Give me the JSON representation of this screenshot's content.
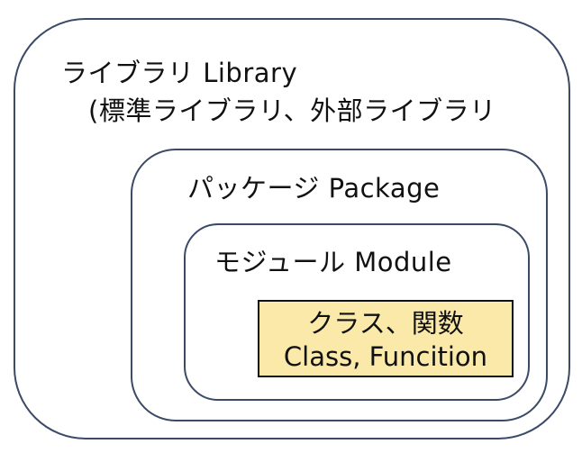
{
  "diagram": {
    "library": {
      "title": "ライブラリ Library",
      "subtitle": "(標準ライブラリ、外部ライブラリ"
    },
    "package": {
      "title": "パッケージ Package"
    },
    "module": {
      "title": "モジュール Module"
    },
    "class_function": {
      "line1": "クラス、関数",
      "line2": "Class, Funcition"
    }
  },
  "colors": {
    "border": "#3b4a66",
    "highlight_fill": "#fae9a8",
    "highlight_border": "#111111",
    "text": "#111111",
    "background": "#ffffff"
  }
}
